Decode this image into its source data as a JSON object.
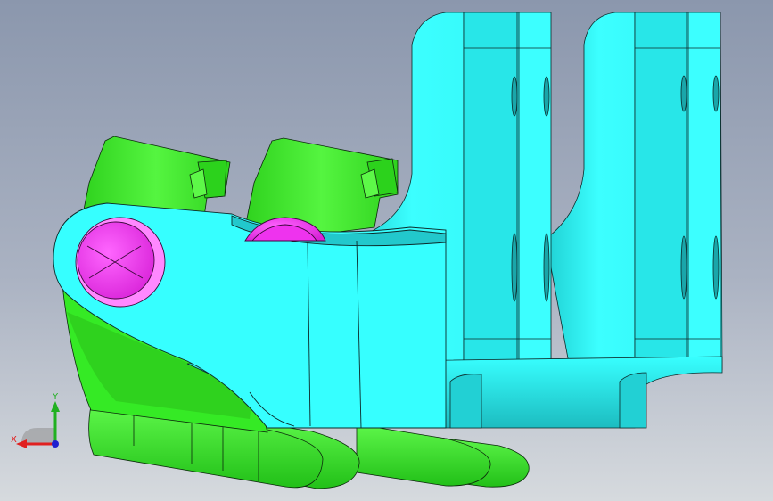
{
  "viewport": {
    "background_top": "#8b97ad",
    "background_bottom": "#d6dade"
  },
  "model": {
    "colors": {
      "cyan_part": "#33ffff",
      "cyan_dark": "#1ec9cc",
      "green_part": "#33ee22",
      "green_dark": "#1fa814",
      "pin": "#ee33ee",
      "pin_light": "#ff99ff",
      "edge": "#0c2a2a"
    }
  },
  "triad": {
    "x_label": "X",
    "y_label": "Y",
    "x_color": "#e02020",
    "y_color": "#20b020",
    "z_color": "#2020d0",
    "icon": "coordinate-triad-icon"
  }
}
